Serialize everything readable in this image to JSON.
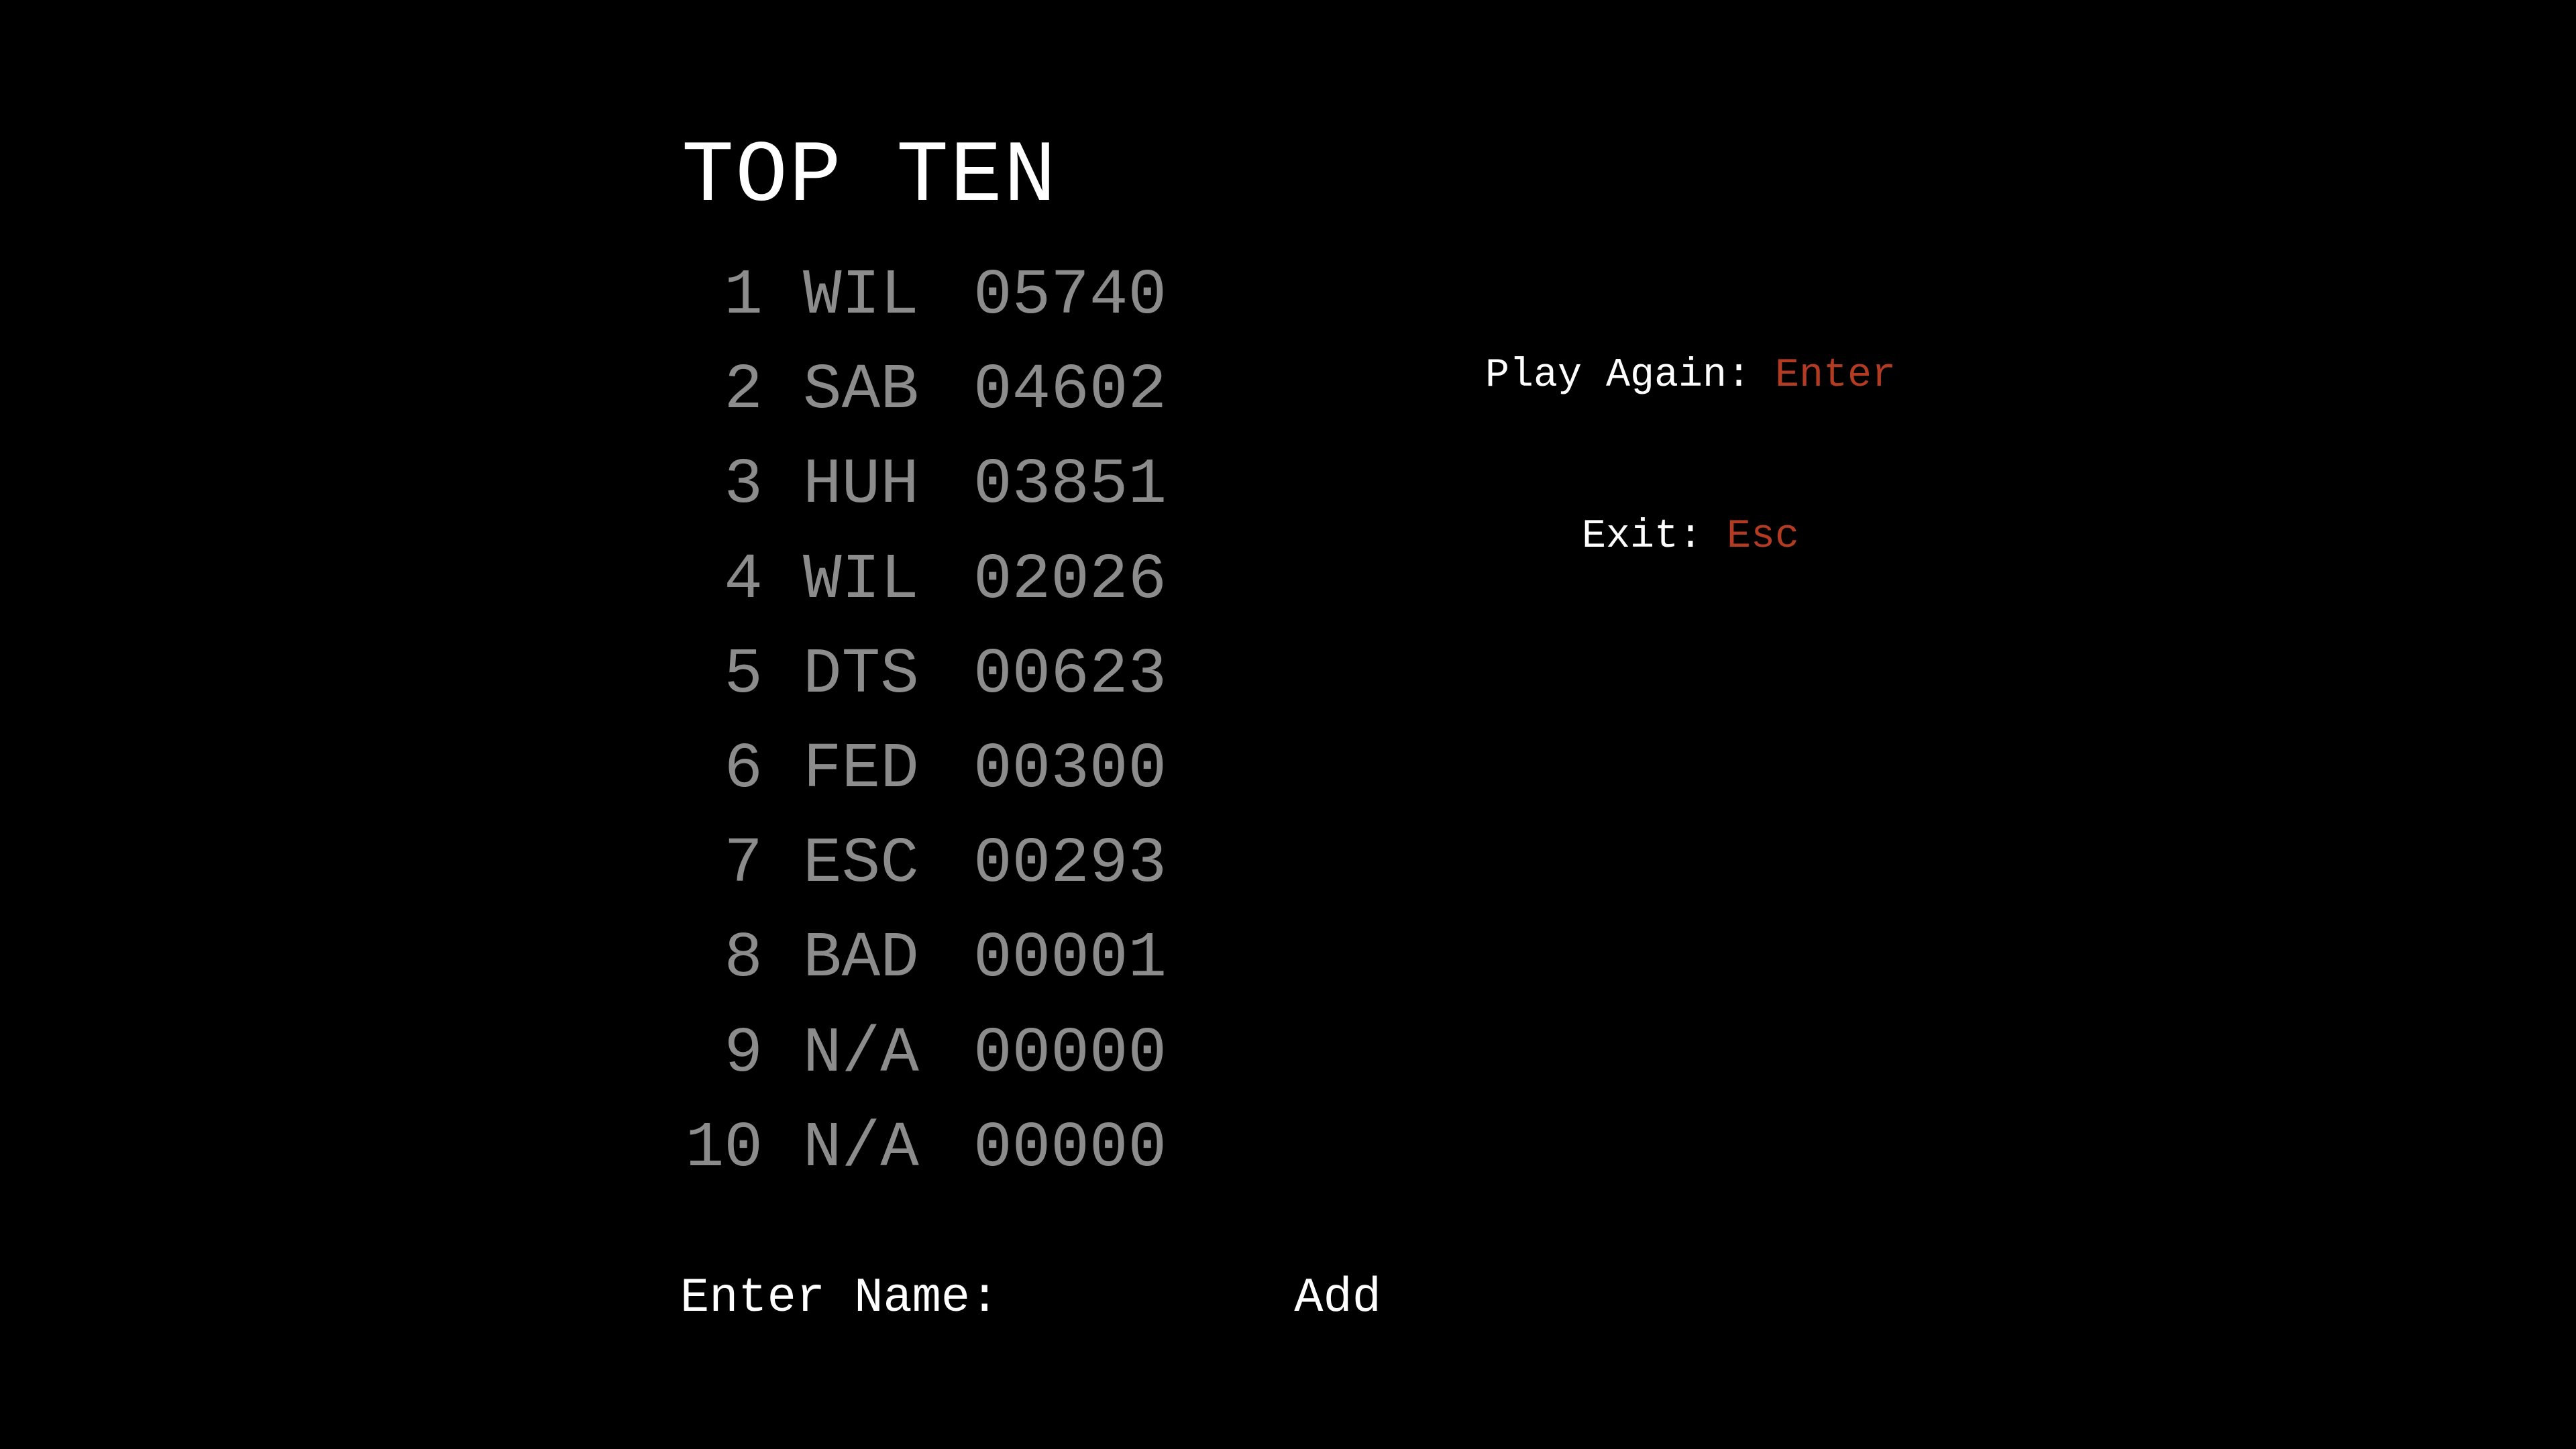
{
  "title": "TOP TEN",
  "leaderboard": [
    {
      "rank": "1",
      "name": "WIL",
      "score": "05740"
    },
    {
      "rank": "2",
      "name": "SAB",
      "score": "04602"
    },
    {
      "rank": "3",
      "name": "HUH",
      "score": "03851"
    },
    {
      "rank": "4",
      "name": "WIL",
      "score": "02026"
    },
    {
      "rank": "5",
      "name": "DTS",
      "score": "00623"
    },
    {
      "rank": "6",
      "name": "FED",
      "score": "00300"
    },
    {
      "rank": "7",
      "name": "ESC",
      "score": "00293"
    },
    {
      "rank": "8",
      "name": "BAD",
      "score": "00001"
    },
    {
      "rank": "9",
      "name": "N/A",
      "score": "00000"
    },
    {
      "rank": "10",
      "name": "N/A",
      "score": "00000"
    }
  ],
  "controls": {
    "play_again_label": "Play Again: ",
    "play_again_key": "Enter",
    "exit_label": "Exit: ",
    "exit_key": "Esc"
  },
  "entry": {
    "label": "Enter Name:",
    "value": "",
    "add_label": "Add"
  },
  "colors": {
    "background": "#000000",
    "title": "#ffffff",
    "score_text": "#8c8c8c",
    "key_highlight": "#b23b22"
  }
}
